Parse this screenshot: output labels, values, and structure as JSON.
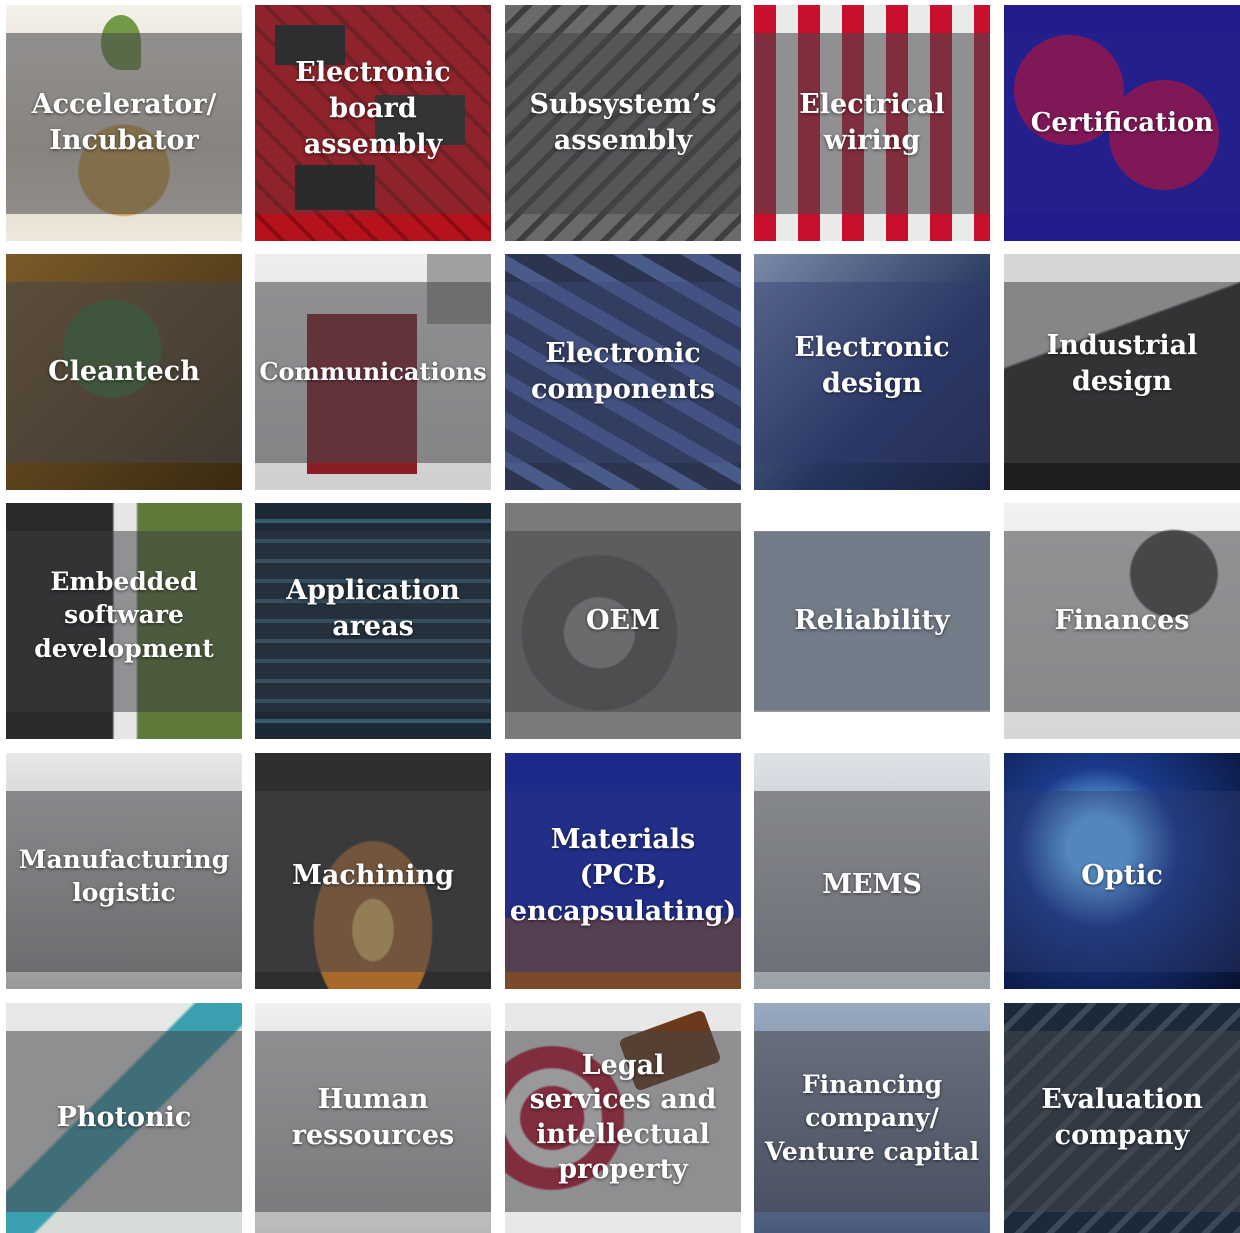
{
  "tiles": [
    {
      "label": "Accelerator/\nIncubator",
      "icon": "plant-coins-icon",
      "colors": [
        "#d9d2c4",
        "#f3efe6"
      ]
    },
    {
      "label": "Electronic\nboard\nassembly",
      "icon": "circuit-board-icon",
      "colors": [
        "#b5121b",
        "#2a2a2a"
      ]
    },
    {
      "label": "Subsystem’s\nassembly",
      "icon": "subsystem-board-icon",
      "colors": [
        "#5a5a5a",
        "#9a9a9a"
      ]
    },
    {
      "label": "Electrical\nwiring",
      "icon": "wiring-icon",
      "colors": [
        "#c8102e",
        "#ececec"
      ]
    },
    {
      "label": "Certification",
      "icon": "price-tag-icon",
      "colors": [
        "#1e1a8a",
        "#c8102e"
      ]
    },
    {
      "label": "Cleantech",
      "icon": "eco-bulb-icon",
      "colors": [
        "#6b4a1d",
        "#2f3b1a"
      ]
    },
    {
      "label": "Communications",
      "icon": "puzzle-piece-icon",
      "colors": [
        "#e6e6e6",
        "#8a1e26"
      ]
    },
    {
      "label": "Electronic\ncomponents",
      "icon": "chip-components-icon",
      "colors": [
        "#3a4a7a",
        "#1e2330"
      ]
    },
    {
      "label": "Electronic\ndesign",
      "icon": "design-board-icon",
      "colors": [
        "#2a3a6a",
        "#6a7a9a"
      ]
    },
    {
      "label": "Industrial\ndesign",
      "icon": "enclosure-icon",
      "colors": [
        "#bfbfbf",
        "#1c1c1c"
      ]
    },
    {
      "label": "Embedded\nsoftware\ndevelopment",
      "icon": "embedded-board-icon",
      "colors": [
        "#2a2a2a",
        "#5d7a3a"
      ]
    },
    {
      "label": "Application\nareas",
      "icon": "cockpit-icon",
      "colors": [
        "#1b2a3a",
        "#3b5a6a"
      ]
    },
    {
      "label": "OEM",
      "icon": "gears-icon",
      "colors": [
        "#4a4a4a",
        "#8a8a8a"
      ]
    },
    {
      "label": "Reliability",
      "icon": "handshake-icon",
      "colors": [
        "#9ab0c8",
        "#e0e0e0"
      ]
    },
    {
      "label": "Finances",
      "icon": "lightbulb-icon",
      "colors": [
        "#f0f0f0",
        "#303030"
      ]
    },
    {
      "label": "Manufacturing\nlogistic",
      "icon": "factory-icon",
      "colors": [
        "#cfcfcf",
        "#5a5a5a"
      ]
    },
    {
      "label": "Machining",
      "icon": "laser-cutter-icon",
      "colors": [
        "#3a3a3a",
        "#c48a2a"
      ]
    },
    {
      "label": "Materials\n(PCB,\nencapsulating)",
      "icon": "materials-icon",
      "colors": [
        "#1e2a8a",
        "#c8a040"
      ]
    },
    {
      "label": "MEMS",
      "icon": "cleanroom-icon",
      "colors": [
        "#d0d4da",
        "#8a9098"
      ]
    },
    {
      "label": "Optic",
      "icon": "fiber-optic-icon",
      "colors": [
        "#0a1a4a",
        "#4aa0e0"
      ]
    },
    {
      "label": "Photonic",
      "icon": "photonic-fiber-icon",
      "colors": [
        "#d8dcd8",
        "#3aa0b0"
      ]
    },
    {
      "label": "Human\nressources",
      "icon": "people-network-icon",
      "colors": [
        "#dcdcdc",
        "#9a9a9a"
      ]
    },
    {
      "label": "Legal\nservices and\nintellectual\nproperty",
      "icon": "gavel-icon",
      "colors": [
        "#c8102e",
        "#6a3a1a"
      ]
    },
    {
      "label": "Financing\ncompany/\nVenture capital",
      "icon": "dollar-signs-icon",
      "colors": [
        "#8a9ab0",
        "#4a5a7a"
      ]
    },
    {
      "label": "Evaluation\ncompany",
      "icon": "idea-handshake-icon",
      "colors": [
        "#1a2a3a",
        "#5a6a7a"
      ]
    }
  ]
}
